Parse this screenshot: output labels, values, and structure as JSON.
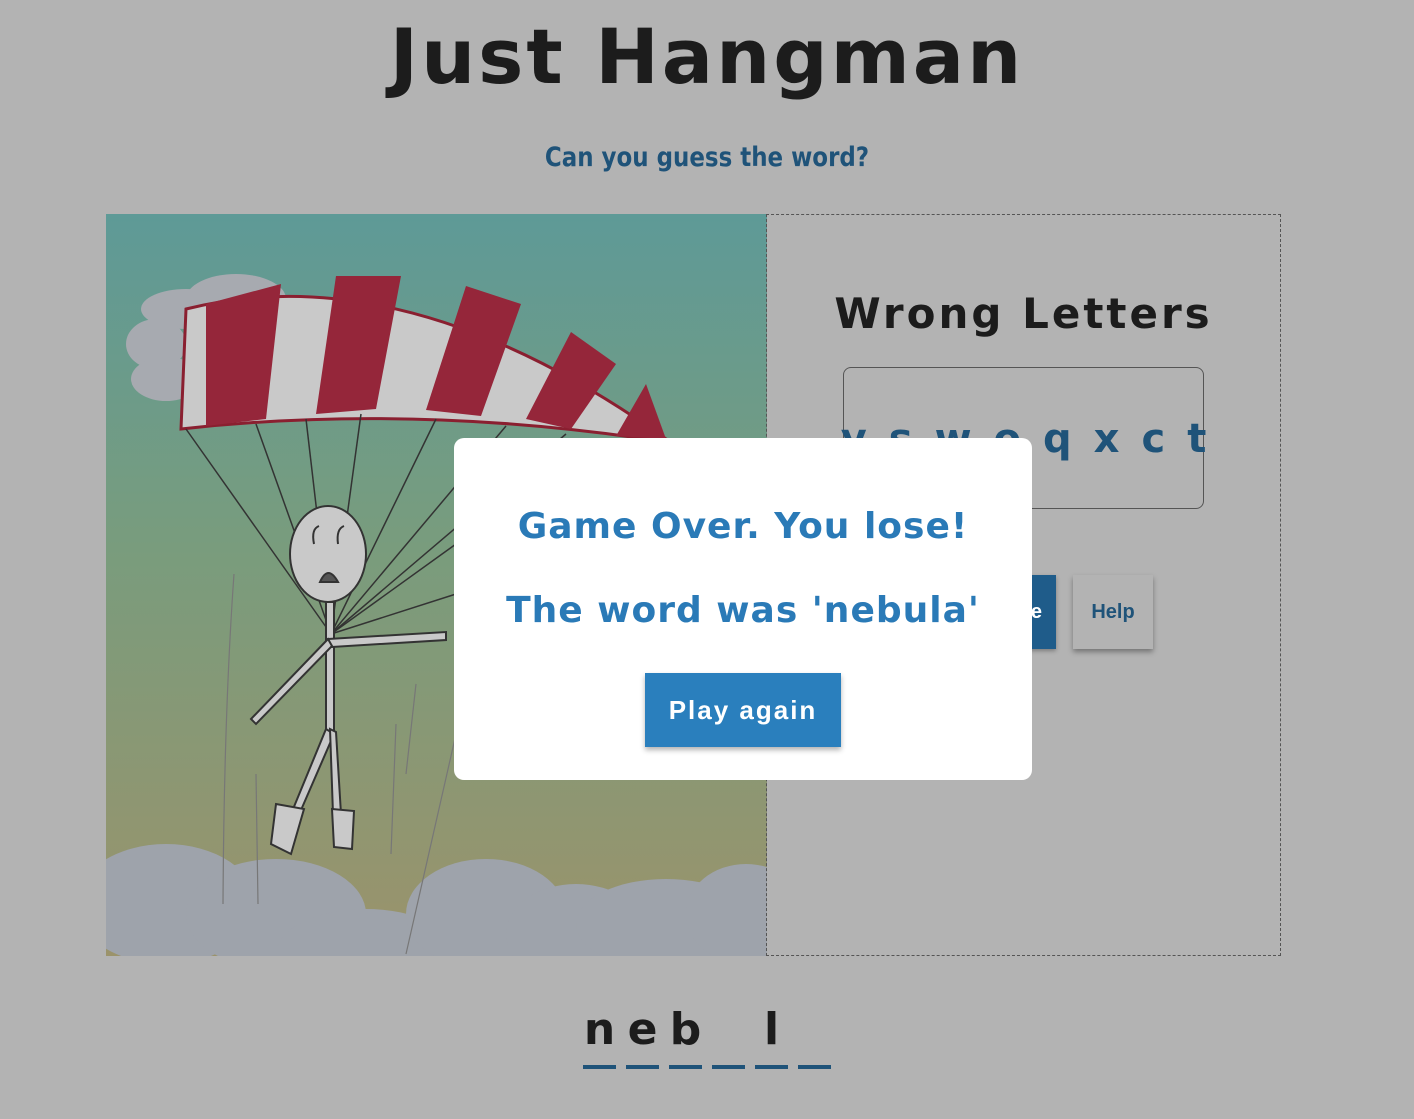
{
  "header": {
    "title": "Just Hangman",
    "subtitle": "Can you guess the word?"
  },
  "illustration": {
    "description_icon": "parachute-stickman-icon"
  },
  "wrong_letters": {
    "title": "Wrong Letters",
    "letters": [
      "y",
      "s",
      "w",
      "o",
      "q",
      "x",
      "c",
      "t"
    ]
  },
  "buttons": {
    "hint_label": "e",
    "help_label": "Help"
  },
  "word": {
    "slots": [
      "n",
      "e",
      "b",
      "",
      "l",
      ""
    ]
  },
  "modal": {
    "message": "Game Over. You lose!",
    "reveal": "The word was 'nebula'",
    "play_again_label": "Play again"
  },
  "colors": {
    "background_overlay": "#b3b3b3",
    "accent_blue": "#2a7ab7",
    "dark_blue": "#1f5379",
    "parachute_red": "#9b2335"
  }
}
